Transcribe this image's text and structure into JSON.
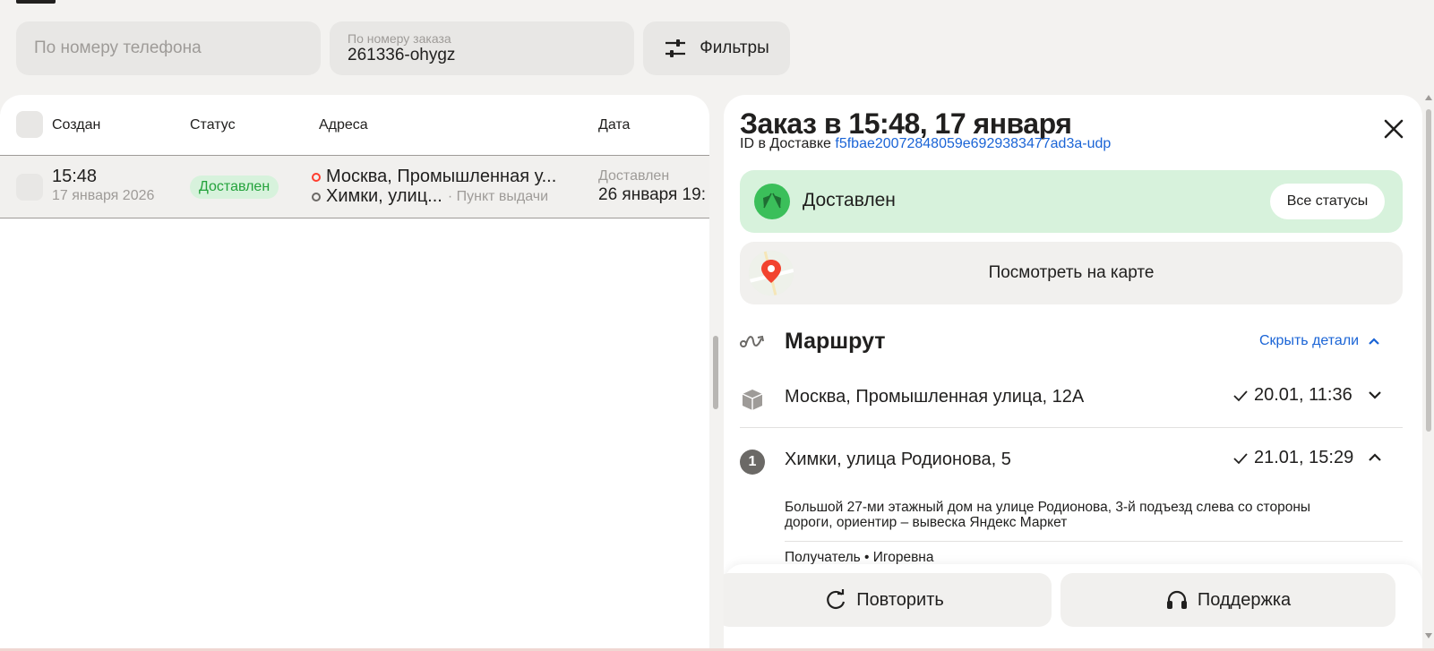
{
  "search": {
    "phone_placeholder": "По номеру телефона",
    "order_label": "По номеру заказа",
    "order_value": "261336-ohygz",
    "filters_label": "Фильтры"
  },
  "table": {
    "columns": [
      "Создан",
      "Статус",
      "Адреса",
      "Дата"
    ],
    "rows": [
      {
        "time": "15:48",
        "date": "17 января 2026",
        "status": "Доставлен",
        "address_from": "Москва, Промышленная у...",
        "address_to": "Химки, улиц...",
        "address_to_type": "· Пункт выдачи",
        "date_label": "Доставлен",
        "date_value": "26 января 19:"
      }
    ]
  },
  "details": {
    "title": "Заказ в 15:48, 17 января",
    "id_prefix": "ID в Доставке",
    "id_value": "f5fbae20072848059e6929383477ad3a-udp",
    "status": "Доставлен",
    "all_statuses": "Все статусы",
    "map_button": "Посмотреть на карте",
    "route_title": "Маршрут",
    "hide_details": "Скрыть детали",
    "route": [
      {
        "address": "Москва, Промышленная улица, 12А",
        "time": "20.01, 11:36"
      },
      {
        "number": "1",
        "address": "Химки, улица Родионова, 5",
        "time": "21.01, 15:29"
      }
    ],
    "note": "Большой 27-ми этажный дом на улице Родионова, 3-й подъезд слева со стороны дороги, ориентир – вывеска Яндекс Маркет",
    "recipient": "Получатель • Игоревна",
    "repeat_button": "Повторить",
    "support_button": "Поддержка"
  },
  "colors": {
    "accent_green": "#3bbf5a",
    "status_bg": "#d7f2dc",
    "link_blue": "#1a64d6"
  }
}
